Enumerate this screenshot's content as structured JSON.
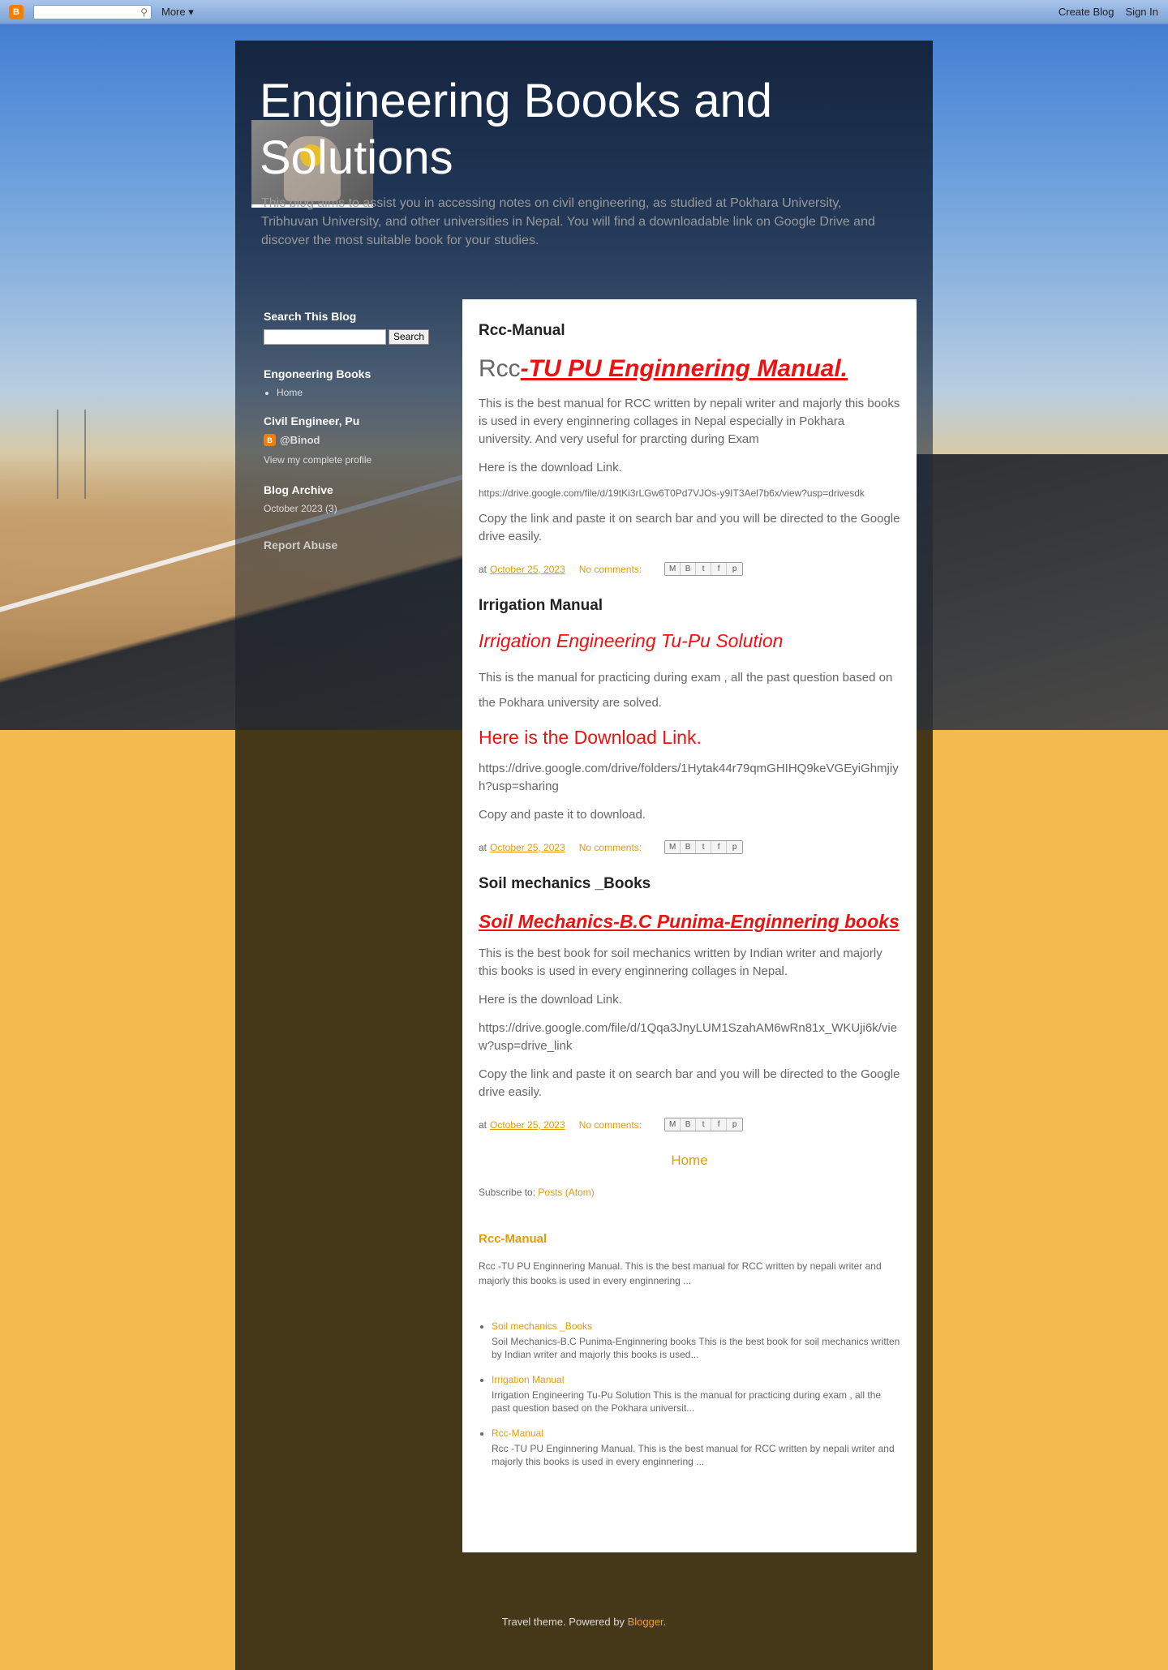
{
  "navbar": {
    "more": "More",
    "create_blog": "Create Blog",
    "sign_in": "Sign In"
  },
  "header": {
    "title": "Engineering Boooks and Solutions",
    "description": "This blog aims to assist you in accessing notes on civil engineering, as studied at Pokhara University, Tribhuvan University, and other universities in Nepal. You will find a downloadable link on Google Drive and discover the most suitable book for your studies."
  },
  "sidebar": {
    "search_heading": "Search This Blog",
    "search_button": "Search",
    "pages_heading": "Engoneering Books",
    "pages": [
      "Home"
    ],
    "about_heading": "Civil Engineer, Pu",
    "profile_name": "@Binod",
    "profile_link": "View my complete profile",
    "archive_heading": "Blog Archive",
    "archive_item": "October 2023 (3)",
    "report_abuse": "Report Abuse"
  },
  "posts": [
    {
      "title": "Rcc-Manual",
      "headline_plain": "Rcc",
      "headline_link": "-TU PU Enginnering Manual.",
      "body": "This is the best manual for RCC written by nepali writer and majorly this books is used in every enginnering collages in Nepal especially in Pokhara university. And very useful for prarcting during Exam",
      "download_intro": "Here is the download Link.",
      "url": "https://drive.google.com/file/d/19tKi3rLGw6T0Pd7VJOs-y9IT3Ael7b6x/view?usp=drivesdk",
      "instruction": "Copy the link and paste it on search bar and you will be directed to the Google drive easily.",
      "at": "at",
      "date": "October 25, 2023",
      "comments": "No comments:"
    },
    {
      "title": "Irrigation Manual",
      "headline": " Irrigation Engineering Tu-Pu Solution",
      "body": "This is the manual for practicing during exam , all the past question based on the Pokhara university  are solved.",
      "download_heading": "Here is the Download Link.",
      "url": "https://drive.google.com/drive/folders/1Hytak44r79qmGHIHQ9keVGEyiGhmjiyh?usp=sharing",
      "instruction": "Copy and paste it to download.",
      "at": "at",
      "date": "October 25, 2023",
      "comments": "No comments:"
    },
    {
      "title": "Soil mechanics _Books",
      "headline": "Soil Mechanics-B.C Punima-Enginnering books",
      "body": "This is the best book for soil mechanics written by Indian writer and majorly this books is used in every enginnering collages in Nepal.",
      "download_intro": "Here is the download Link.",
      "url": "https://drive.google.com/file/d/1Qqa3JnyLUM1SzahAM6wRn81x_WKUji6k/view?usp=drive_link",
      "instruction": "Copy the link and paste it on search bar and you will be directed to the Google drive easily.",
      "at": "at",
      "date": "October 25, 2023",
      "comments": "No comments:"
    }
  ],
  "home_link": "Home",
  "subscribe": {
    "label": "Subscribe to:",
    "link": "Posts (Atom)"
  },
  "featured": {
    "title": "Rcc-Manual",
    "snippet": "Rcc -TU PU Enginnering Manual. This is the best manual for RCC written by nepali writer and majorly this books is used in every enginnering ..."
  },
  "popular_posts": [
    {
      "title": "Soil mechanics _Books",
      "snippet": "Soil Mechanics-B.C Punima-Enginnering books This is the best book for soil mechanics written by Indian writer and majorly this books is used..."
    },
    {
      "title": "Irrigation Manual",
      "snippet": "  Irrigation Engineering Tu-Pu Solution This is the manual for practicing during exam , all the past question based on the Pokhara universit..."
    },
    {
      "title": "Rcc-Manual",
      "snippet": "Rcc -TU PU Enginnering Manual. This is the best manual for RCC written by nepali writer and majorly this books is used in every enginnering ..."
    }
  ],
  "credit": {
    "text": "Travel theme. Powered by",
    "link": "Blogger",
    "end": "."
  },
  "colors": {
    "accent": "#e69a00",
    "red_link": "#ee1111",
    "background": "#f3bb4f",
    "outer_dark": "#453819"
  }
}
